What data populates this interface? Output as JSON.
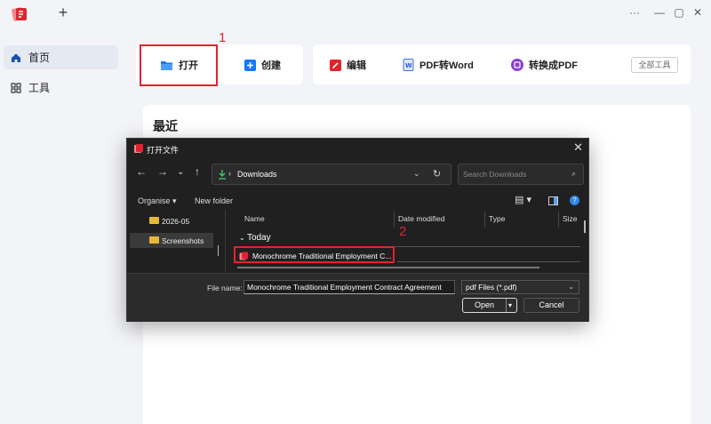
{
  "titlebar": {
    "new_tab_label": "+",
    "controls": {
      "more": "···",
      "minimize": "—",
      "maximize": "▢",
      "close": "✕"
    }
  },
  "sidebar": {
    "items": [
      {
        "label": "首页",
        "icon": "home-icon",
        "active": true
      },
      {
        "label": "工具",
        "icon": "grid-icon",
        "active": false
      }
    ]
  },
  "toolbar": {
    "open_label": "打开",
    "create_label": "创建",
    "edit_label": "编辑",
    "pdf_to_word_label": "PDF转Word",
    "convert_to_pdf_label": "转换成PDF",
    "all_tools_label": "全部工具",
    "step1": "1"
  },
  "recent": {
    "title": "最近"
  },
  "dialog": {
    "title": "打开文件",
    "address": "Downloads",
    "search_placeholder": "Search Downloads",
    "organise_label": "Organise",
    "new_folder_label": "New folder",
    "nav_items": [
      {
        "label": "2026-05",
        "selected": false
      },
      {
        "label": "Screenshots",
        "selected": true
      }
    ],
    "columns": {
      "name": "Name",
      "date": "Date modified",
      "type": "Type",
      "size": "Size"
    },
    "group_label": "Today",
    "file_name_item": "Monochrome Traditional Employment C...",
    "step2": "2",
    "file_name_label": "File name:",
    "file_name_value": "Monochrome Traditional Employment Contract Agreement",
    "file_type": "pdf Files (*.pdf)",
    "open_button": "Open",
    "cancel_button": "Cancel"
  },
  "colors": {
    "accent_blue": "#1677ff",
    "highlight_red": "#e2232d",
    "dialog_bg": "#202020"
  }
}
